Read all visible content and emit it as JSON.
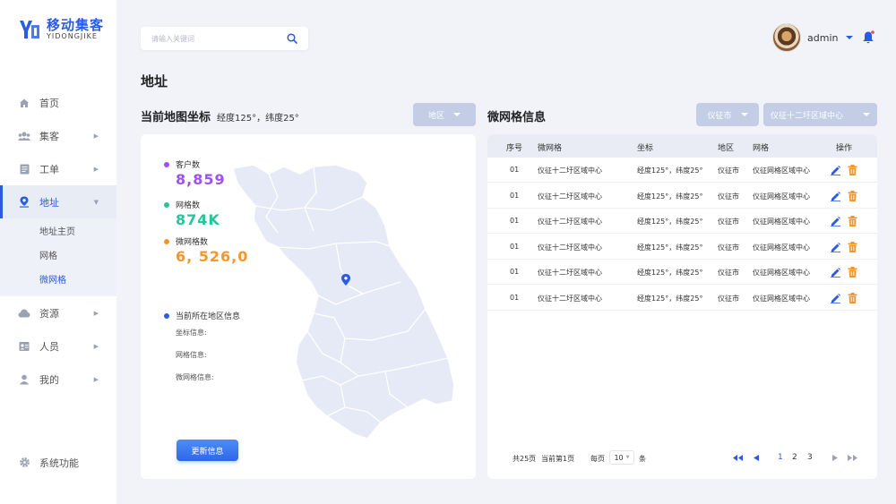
{
  "app": {
    "logo_title": "移动集客",
    "logo_sub": "YIDONGJIKE"
  },
  "sidebar": {
    "items": [
      {
        "label": "首页",
        "icon": "home-icon"
      },
      {
        "label": "集客",
        "icon": "group-icon"
      },
      {
        "label": "工单",
        "icon": "document-icon"
      },
      {
        "label": "地址",
        "icon": "location-icon"
      },
      {
        "label": "资源",
        "icon": "cloud-icon"
      },
      {
        "label": "人员",
        "icon": "contacts-icon"
      },
      {
        "label": "我的",
        "icon": "user-icon"
      }
    ],
    "sub_items": [
      "地址主页",
      "网格",
      "微网格"
    ],
    "bottom": {
      "label": "系统功能",
      "icon": "gear-icon"
    }
  },
  "search": {
    "placeholder": "请输入关键词"
  },
  "user": {
    "name": "admin"
  },
  "page_title": "地址",
  "left_section": {
    "title": "当前地图坐标",
    "coords": "经度125°，纬度25°",
    "dropdown": "地区",
    "stats": [
      {
        "label": "客户数",
        "value": "8,859",
        "color": "#a24ff0"
      },
      {
        "label": "网格数",
        "value": "874K",
        "color": "#26c59b"
      },
      {
        "label": "微网格数",
        "value": "6, 526,0",
        "color": "#f5962a"
      }
    ],
    "info_title": "当前所在地区信息",
    "info_lines": [
      "坐标信息:",
      "网格信息:",
      "微网格信息:"
    ],
    "button": "更新信息",
    "info_dot_color": "#2b5be0"
  },
  "right_section": {
    "title": "微网格信息",
    "dropdown_city": "仪征市",
    "dropdown_area": "仪征十二圩区域中心",
    "columns": [
      "序号",
      "微网格",
      "坐标",
      "地区",
      "网格",
      "操作"
    ],
    "rows": [
      [
        "01",
        "仪征十二圩区域中心",
        "经度125°，纬度25°",
        "仪征市",
        "仪征网格区域中心"
      ],
      [
        "01",
        "仪征十二圩区域中心",
        "经度125°，纬度25°",
        "仪征市",
        "仪征网格区域中心"
      ],
      [
        "01",
        "仪征十二圩区域中心",
        "经度125°，纬度25°",
        "仪征市",
        "仪征网格区域中心"
      ],
      [
        "01",
        "仪征十二圩区域中心",
        "经度125°，纬度25°",
        "仪征市",
        "仪征网格区域中心"
      ],
      [
        "01",
        "仪征十二圩区域中心",
        "经度125°，纬度25°",
        "仪征市",
        "仪征网格区域中心"
      ],
      [
        "01",
        "仪征十二圩区域中心",
        "经度125°，纬度25°",
        "仪征市",
        "仪征网格区域中心"
      ]
    ],
    "pager": {
      "total": "共25页",
      "current": "当前第1页",
      "per_page_label": "每页",
      "per_page_value": "10",
      "unit": "条",
      "pages": [
        "1",
        "2",
        "3"
      ]
    }
  }
}
